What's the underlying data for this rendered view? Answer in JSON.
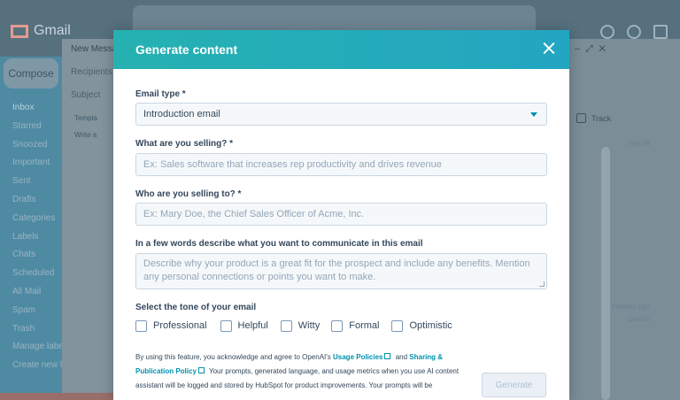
{
  "background": {
    "app_name": "Gmail",
    "compose_label": "Compose",
    "sidebar_items": [
      "Inbox",
      "Starred",
      "Snoozed",
      "Important",
      "Sent",
      "Drafts",
      "Categories",
      "Labels",
      "Chats",
      "Scheduled",
      "All Mail",
      "Spam",
      "Trash",
      "Manage labels",
      "Create new label"
    ],
    "composer": {
      "title": "New Messa",
      "recipients": "Recipients",
      "subject": "Subject",
      "template": "Templa",
      "write": "Write a"
    },
    "right_panel": {
      "track_label": "Track",
      "date_1": "Feb 28",
      "date_2": "minutes ago",
      "details": "Details"
    }
  },
  "modal": {
    "title": "Generate content",
    "email_type": {
      "label": "Email type *",
      "value": "Introduction email"
    },
    "selling_what": {
      "label": "What are you selling? *",
      "placeholder": "Ex: Sales software that increases rep productivity and drives revenue"
    },
    "selling_to": {
      "label": "Who are you selling to? *",
      "placeholder": "Ex: Mary Doe, the Chief Sales Officer of Acme, Inc."
    },
    "communicate": {
      "label": "In a few words describe what you want to communicate in this email",
      "placeholder": "Describe why your product is a great fit for the prospect and include any benefits. Mention any personal connections or points you want to make."
    },
    "tone": {
      "label": "Select the tone of your email",
      "options": [
        "Professional",
        "Helpful",
        "Witty",
        "Formal",
        "Optimistic"
      ]
    },
    "legal": {
      "text_1": "By using this feature, you acknowledge and agree to OpenAI's ",
      "link_usage": "Usage Policies",
      "text_2": " and ",
      "link_sharing": "Sharing & Publication Policy",
      "text_3": " Your prompts, generated language, and usage metrics when you use AI content assistant will be logged and stored by HubSpot for product improvements. Your prompts will be"
    },
    "generate_label": "Generate"
  }
}
